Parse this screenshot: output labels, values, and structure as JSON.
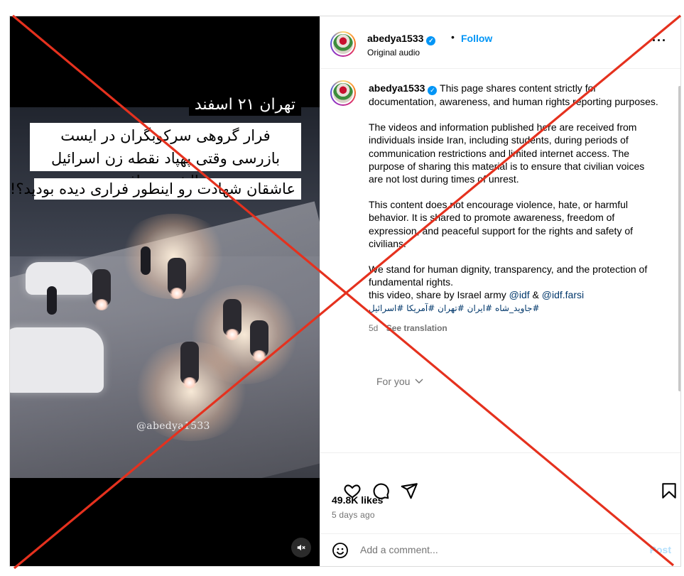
{
  "video": {
    "caption_date": "تهران ۲۱ اسفند",
    "caption_line1": "فرار گروهی سرکوبگران در ایست بازرسی وقتی پهپاد نقطه زن اسرائیل دنبالشون میافته",
    "caption_line3": "عاشقان شهادت رو اینطور فراری دیده بودید؟!",
    "watermark": "@abedya1533",
    "mute_icon": "speaker-muted-icon"
  },
  "header": {
    "username": "abedya1533",
    "separator": "•",
    "follow_label": "Follow",
    "audio": "Original audio",
    "more_label": "···"
  },
  "post": {
    "username": "abedya1533",
    "p1": "This page shares content strictly for documentation, awareness, and human rights reporting purposes.",
    "p2": "The videos and information published here are received from individuals inside Iran, including students, during periods of communication restrictions and limited internet access. The purpose of sharing this material is to ensure that civilian voices are not lost during times of unrest.",
    "p3": "This content does not encourage violence, hate, or harmful behavior. It is shared to promote awareness, freedom of expression, and peaceful support for the rights and safety of civilians.",
    "p4": "We stand for human dignity, transparency, and the protection of fundamental rights.",
    "p5_prefix": "this video, share by Israel army",
    "mention1": "@idf",
    "amp": "&",
    "mention2": "@idf.farsi",
    "hashtags": "#جاوید_شاه #ایران #تهران #آمریکا #اسرائیل",
    "age": "5d",
    "see_translation": "See translation",
    "for_you": "For you"
  },
  "actions": {
    "likes": "49.8K likes",
    "posted": "5 days ago",
    "comment_placeholder": "Add a comment...",
    "post_label": "Post"
  },
  "overlay": {
    "color": "#e5311e"
  }
}
